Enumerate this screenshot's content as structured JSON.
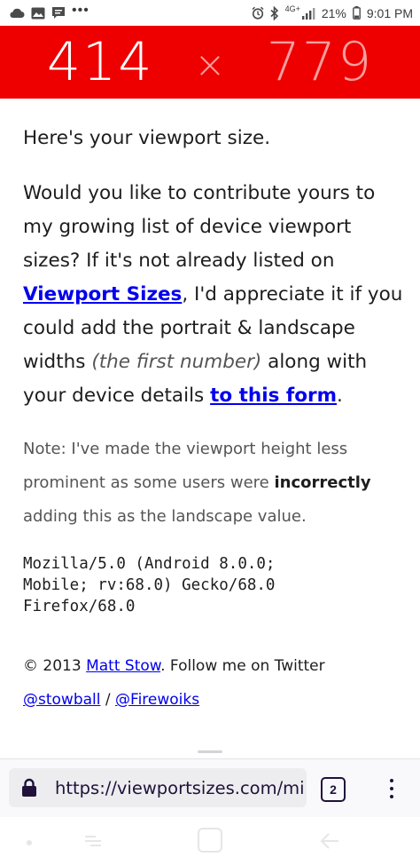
{
  "status_bar": {
    "network": "4G+",
    "battery": "21%",
    "time": "9:01 PM",
    "more": "•••"
  },
  "viewport": {
    "width": "414",
    "separator": "×",
    "height": "779"
  },
  "content": {
    "intro": "Here's your viewport size.",
    "para_1": "Would you like to contribute yours to my growing list of device viewport sizes? If it's not already listed on ",
    "link_viewport_sizes": "Viewport Sizes",
    "para_2": ", I'd appreciate it if you could add the portrait & landscape widths ",
    "para_em": "(the first number)",
    "para_3": " along with your device details ",
    "link_form": "to this form",
    "para_4": ".",
    "note_1": "Note: I've made the viewport height less prominent as some users were ",
    "note_bold": "incorrectly",
    "note_2": " adding this as the landscape value.",
    "user_agent": "Mozilla/5.0 (Android 8.0.0;\nMobile; rv:68.0) Gecko/68.0\nFirefox/68.0",
    "footer_prefix": "© 2013 ",
    "footer_author": "Matt Stow",
    "footer_follow": ". Follow me on Twitter",
    "twitter_1": "@stowball",
    "footer_sep": " / ",
    "twitter_2": "@Firewoiks"
  },
  "browser": {
    "url": "https://viewportsizes.com/mi",
    "tab_count": "2"
  },
  "colors": {
    "banner": "#ee0000",
    "link": "#0000ee",
    "toolbar": "#f9f9fb"
  }
}
